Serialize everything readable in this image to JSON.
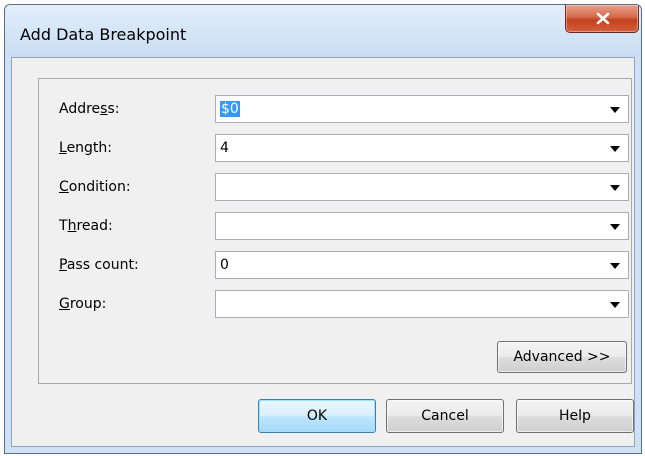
{
  "dialog": {
    "title": "Add Data Breakpoint"
  },
  "fields": [
    {
      "label": "Address:",
      "mnemonic_pre": "Addre",
      "mnemonic_char": "s",
      "mnemonic_post": "s:",
      "value": "$0",
      "selected": true
    },
    {
      "label": "Length:",
      "mnemonic_pre": "",
      "mnemonic_char": "L",
      "mnemonic_post": "ength:",
      "value": "4",
      "selected": false
    },
    {
      "label": "Condition:",
      "mnemonic_pre": "",
      "mnemonic_char": "C",
      "mnemonic_post": "ondition:",
      "value": "",
      "selected": false
    },
    {
      "label": "Thread:",
      "mnemonic_pre": "T",
      "mnemonic_char": "h",
      "mnemonic_post": "read:",
      "value": "",
      "selected": false
    },
    {
      "label": "Pass count:",
      "mnemonic_pre": "",
      "mnemonic_char": "P",
      "mnemonic_post": "ass count:",
      "value": "0",
      "selected": false
    },
    {
      "label": "Group:",
      "mnemonic_pre": "",
      "mnemonic_char": "G",
      "mnemonic_post": "roup:",
      "value": "",
      "selected": false
    }
  ],
  "buttons": {
    "advanced": "Advanced >>",
    "ok": "OK",
    "cancel": "Cancel",
    "help": "Help"
  },
  "icons": {
    "close": "close-icon",
    "dropdown": "chevron-down-icon"
  },
  "colors": {
    "close_button": "#c2401d",
    "selection": "#3399ff",
    "default_button_border": "#3c7fb1"
  }
}
